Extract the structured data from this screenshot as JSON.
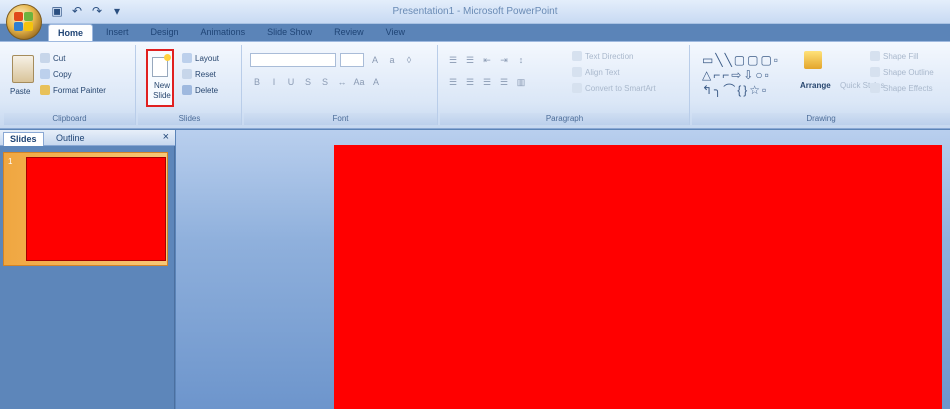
{
  "window": {
    "title": "Presentation1 - Microsoft PowerPoint"
  },
  "qat": {
    "save_icon": "save-icon",
    "undo_icon": "undo-icon",
    "redo_icon": "redo-icon",
    "customize_icon": "customize-icon"
  },
  "tabs": [
    {
      "label": "Home"
    },
    {
      "label": "Insert"
    },
    {
      "label": "Design"
    },
    {
      "label": "Animations"
    },
    {
      "label": "Slide Show"
    },
    {
      "label": "Review"
    },
    {
      "label": "View"
    }
  ],
  "ribbon": {
    "clipboard": {
      "label": "Clipboard",
      "paste": "Paste",
      "cut": "Cut",
      "copy": "Copy",
      "format_painter": "Format Painter"
    },
    "slides": {
      "label": "Slides",
      "new_slide": "New Slide",
      "layout": "Layout",
      "reset": "Reset",
      "delete": "Delete"
    },
    "font": {
      "label": "Font"
    },
    "paragraph": {
      "label": "Paragraph",
      "text_direction": "Text Direction",
      "align_text": "Align Text",
      "convert_smartart": "Convert to SmartArt"
    },
    "drawing": {
      "label": "Drawing",
      "arrange": "Arrange",
      "quick_styles": "Quick Styles",
      "shape_fill": "Shape Fill",
      "shape_outline": "Shape Outline",
      "shape_effects": "Shape Effects"
    }
  },
  "pane": {
    "tab_slides": "Slides",
    "tab_outline": "Outline",
    "close": "×",
    "thumb_number": "1"
  },
  "colors": {
    "slide_fill": "#ff0000",
    "highlight": "#e02020"
  }
}
